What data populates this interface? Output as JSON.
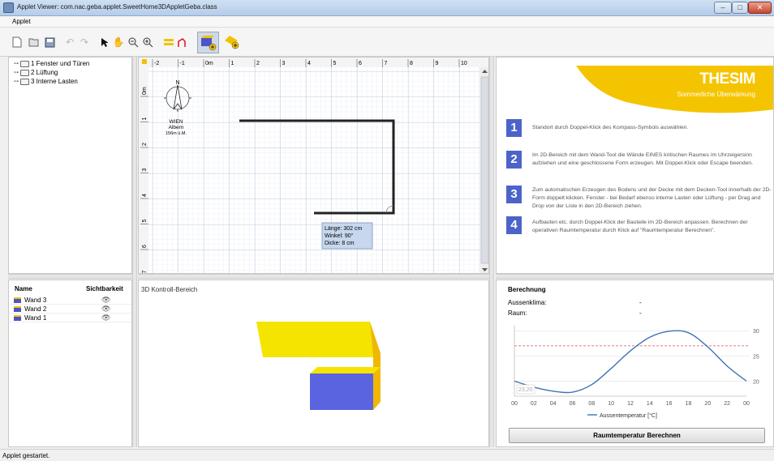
{
  "window": {
    "title": "Applet Viewer: com.nac.geba.applet.SweetHome3DAppletGeba.class",
    "minimize": "–",
    "maximize": "□",
    "close": "✕"
  },
  "menu": {
    "applet": "Applet"
  },
  "toolbar": {
    "items": [
      "new-icon",
      "open-icon",
      "save-icon",
      "undo-icon",
      "redo-icon",
      "select-icon",
      "pan-icon",
      "zoom-out-icon",
      "zoom-in-icon",
      "create-walls-icon",
      "create-dimensions-icon",
      "add-furniture-icon",
      "add-room-icon"
    ]
  },
  "tree": {
    "items": [
      "1 Fenster und Türen",
      "2 Lüftung",
      "3 Interne Lasten"
    ]
  },
  "walltable": {
    "col_name": "Name",
    "col_visibility": "Sichtbarkeit",
    "rows": [
      "Wand 3",
      "Wand 2",
      "Wand 1"
    ]
  },
  "plan": {
    "ruler_x": [
      "-2",
      "-1",
      "0m",
      "1",
      "2",
      "3",
      "4",
      "5",
      "6",
      "7",
      "8",
      "9",
      "10"
    ],
    "ruler_y": [
      "0m",
      "1",
      "2",
      "3",
      "4",
      "5",
      "6",
      "7"
    ],
    "compass": {
      "north": "N",
      "city": "WIEN",
      "place": "Albern",
      "altitude": "156m ü.M."
    },
    "tooltip": [
      "Länge: 302 cm",
      "Winkel: 90°",
      "Dicke: 8 cm"
    ]
  },
  "view3d": {
    "title": "3D Kontroll-Bereich"
  },
  "help": {
    "brand": "THESIM",
    "subtitle": "Sommerliche Überwämung",
    "steps": [
      {
        "num": "1",
        "text": "Standort durch Doppel-Klick des Kompass-Symbols auswählen."
      },
      {
        "num": "2",
        "text": "Im 2D-Bereich mit dem Wand-Tool die Wände EINES kritischen Raumes im Uhrzeigersinn aufziehen und eine geschlossene Form erzeugen. Mit Doppel-Klick oder Escape beenden."
      },
      {
        "num": "3",
        "text": "Zum automatischen Erzeugen des Bodens und der Decke mit dem Decken-Tool innerhalb der 2D-Form doppelt klicken. Fenster - bei Bedarf ebenso interne Lasten oder Lüftung - per Drag and Drop von der Liste in den 2D-Bereich ziehen."
      },
      {
        "num": "4",
        "text": "Aufbauten etc. durch Doppel-Klick der Bauteile im 2D-Bereich anpassen. Berechnen der operativen Raumtemperatur durch Klick auf \"Raumtemperatur Berechnen\"."
      }
    ]
  },
  "calc": {
    "title": "Berechnung",
    "climate_label": "Aussenklima:",
    "climate_value": "-",
    "room_label": "Raum:",
    "room_value": "-",
    "button": "Raumtemperatur Berechnen"
  },
  "chart_data": {
    "type": "line",
    "x": [
      "00",
      "02",
      "04",
      "06",
      "08",
      "10",
      "12",
      "14",
      "16",
      "18",
      "20",
      "22",
      "00"
    ],
    "series": [
      {
        "name": "Aussentemperatur [°C]",
        "values": [
          20.0,
          18.8,
          18.0,
          17.8,
          19.3,
          22.5,
          26.0,
          28.7,
          29.9,
          29.6,
          26.8,
          23.0,
          20.0
        ],
        "color": "#3f73b5"
      }
    ],
    "reference_line": {
      "value": 27,
      "color": "#e36a6a"
    },
    "ylim": [
      17,
      31
    ],
    "yticks": [
      "30",
      "25",
      "20"
    ],
    "cursor_value": "23,20",
    "legend": "bottom"
  },
  "status": {
    "text": "Applet gestartet."
  }
}
